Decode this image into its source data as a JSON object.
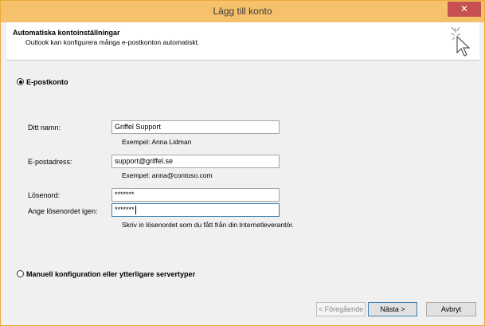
{
  "window": {
    "title": "Lägg till konto",
    "close_label": "✕"
  },
  "header": {
    "title": "Automatiska kontoinställningar",
    "subtitle": "Outlook kan konfigurera många e-postkonton automatiskt."
  },
  "email_account": {
    "radio_label": "E-postkonto",
    "selected": true,
    "name_label": "Ditt namn:",
    "name_value": "Griffel Support",
    "name_hint": "Exempel: Anna Lidman",
    "email_label": "E-postadress:",
    "email_value": "support@griffel.se",
    "email_hint": "Exempel: anna@contoso.com",
    "password_label": "Lösenord:",
    "password_value": "*******",
    "password_repeat_label": "Ange lösenordet igen:",
    "password_repeat_value": "*******",
    "password_hint": "Skriv in lösenordet som du fått från din Internetleverantör."
  },
  "manual_config": {
    "radio_label": "Manuell konfiguration eller ytterligare servertyper",
    "selected": false
  },
  "buttons": {
    "back": "< Föregående",
    "next": "Nästa >",
    "cancel": "Avbryt"
  },
  "icons": {
    "close": "close-icon",
    "wizard": "magic-cursor-icon"
  }
}
